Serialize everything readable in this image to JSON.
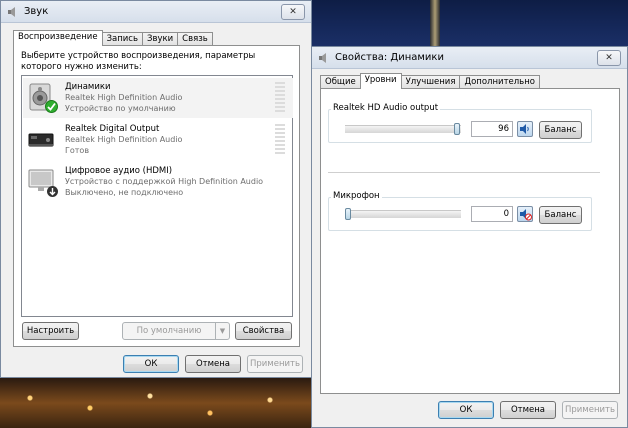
{
  "sound_dialog": {
    "title": "Звук",
    "tabs": [
      {
        "label": "Воспроизведение"
      },
      {
        "label": "Запись"
      },
      {
        "label": "Звуки"
      },
      {
        "label": "Связь"
      }
    ],
    "instruction": "Выберите устройство воспроизведения, параметры которого нужно изменить:",
    "devices": [
      {
        "name": "Динамики",
        "driver": "Realtek High Definition Audio",
        "status": "Устройство по умолчанию",
        "icon": "speakers-icon",
        "badge": "default-check-icon"
      },
      {
        "name": "Realtek Digital Output",
        "driver": "Realtek High Definition Audio",
        "status": "Готов",
        "icon": "digital-output-icon"
      },
      {
        "name": "Цифровое аудио (HDMI)",
        "driver": "Устройство с поддержкой High Definition Audio",
        "status": "Выключено, не подключено",
        "icon": "hdmi-monitor-icon",
        "badge": "disconnected-arrow-icon"
      }
    ],
    "configure_label": "Настроить",
    "default_select": "По умолчанию",
    "properties_label": "Свойства",
    "ok_label": "ОК",
    "cancel_label": "Отмена",
    "apply_label": "Применить"
  },
  "props_dialog": {
    "title": "Свойства: Динамики",
    "tabs": [
      {
        "label": "Общие"
      },
      {
        "label": "Уровни"
      },
      {
        "label": "Улучшения"
      },
      {
        "label": "Дополнительно"
      }
    ],
    "levels": [
      {
        "label": "Realtek HD Audio output",
        "value": "96",
        "level_percent": 96,
        "muted": false,
        "balance_label": "Баланс"
      },
      {
        "label": "Микрофон",
        "value": "0",
        "level_percent": 0,
        "muted": true,
        "balance_label": "Баланс"
      }
    ],
    "ok_label": "ОК",
    "cancel_label": "Отмена",
    "apply_label": "Применить"
  },
  "colors": {
    "accent_check": "#2fae2f",
    "mute_red": "#d22",
    "dialog_bg": "#f0f0f0"
  }
}
